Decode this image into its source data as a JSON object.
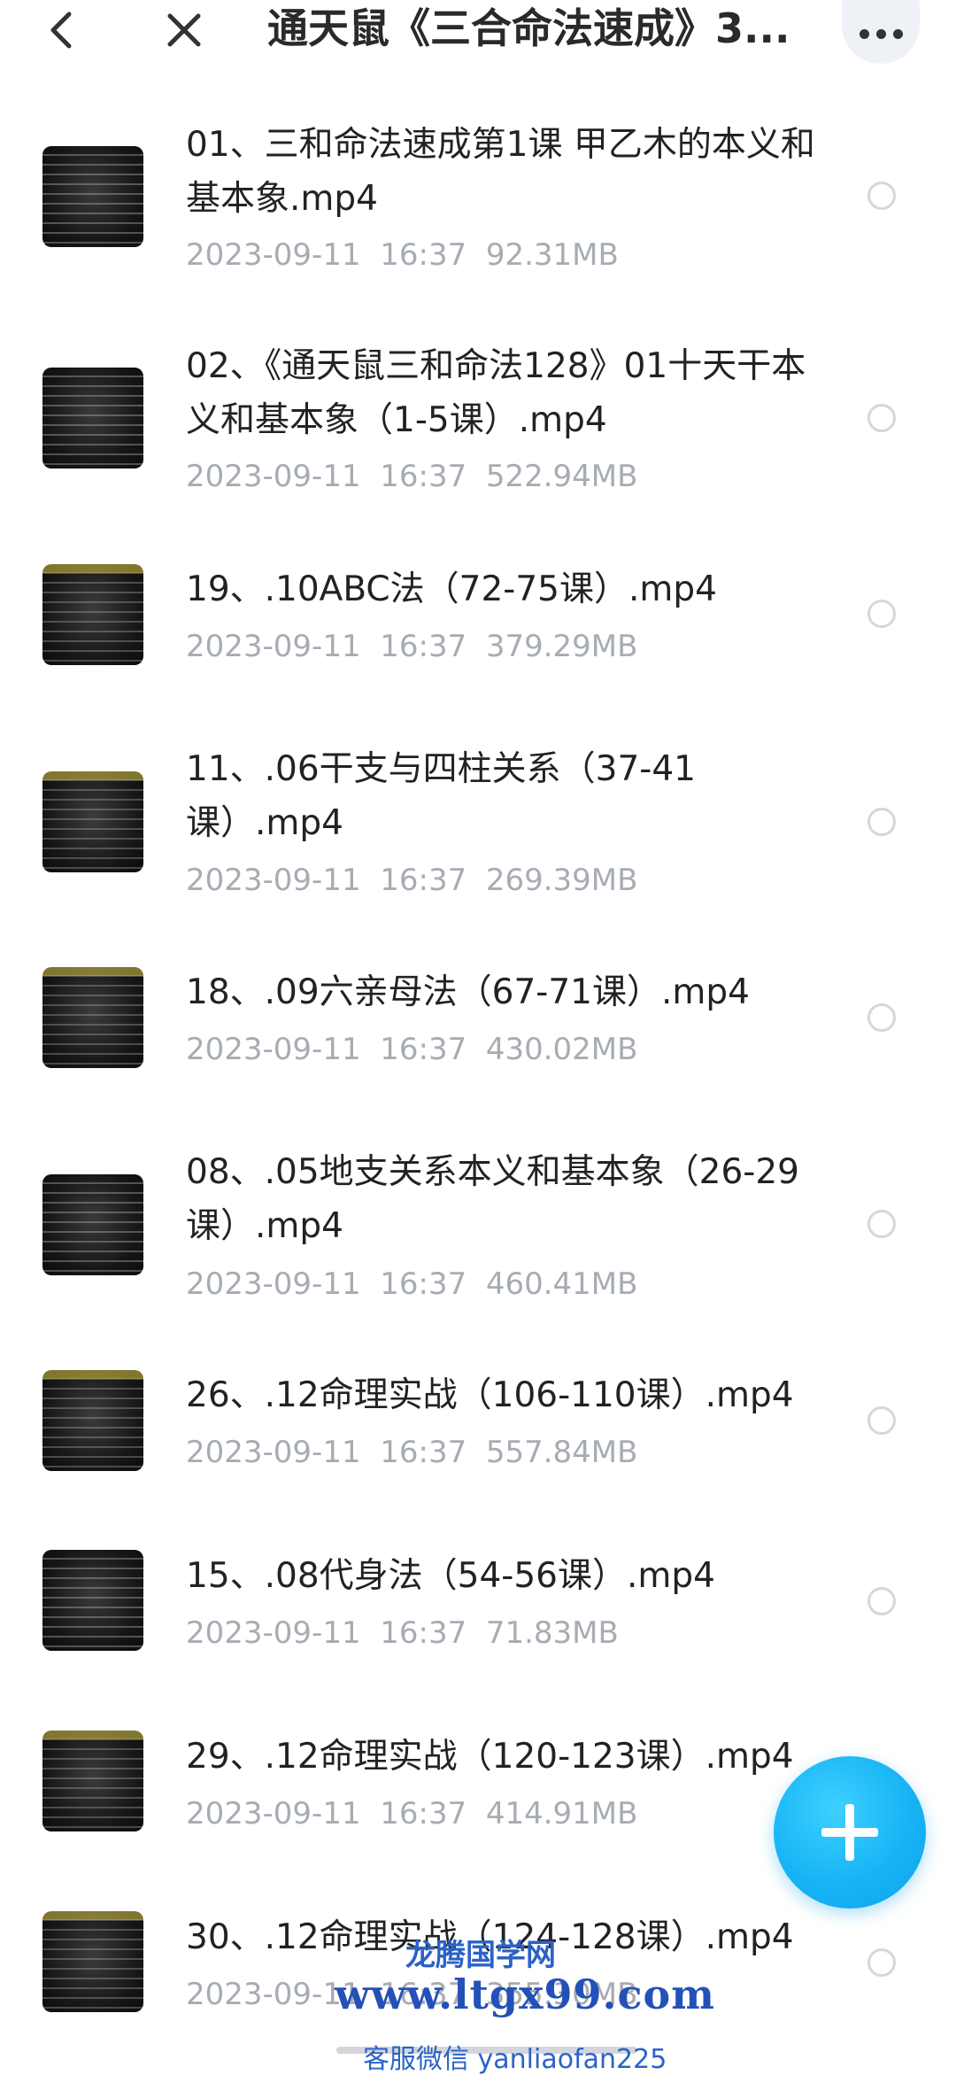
{
  "header": {
    "title": "通天鼠《三合命法速成》3...",
    "back_icon": "chevron-left-icon",
    "close_icon": "close-icon",
    "more_icon": "more-horizontal-icon"
  },
  "files": [
    {
      "name": "01、三和命法速成第1课  甲乙木的本义和基本象.mp4",
      "date": "2023-09-11",
      "time": "16:37",
      "size": "92.31MB"
    },
    {
      "name": "02、《通天鼠三和命法128》01十天干本义和基本象（1-5课）.mp4",
      "date": "2023-09-11",
      "time": "16:37",
      "size": "522.94MB"
    },
    {
      "name": "19、.10ABC法（72-75课）.mp4",
      "date": "2023-09-11",
      "time": "16:37",
      "size": "379.29MB"
    },
    {
      "name": "11、.06干支与四柱关系（37-41课）.mp4",
      "date": "2023-09-11",
      "time": "16:37",
      "size": "269.39MB"
    },
    {
      "name": "18、.09六亲母法（67-71课）.mp4",
      "date": "2023-09-11",
      "time": "16:37",
      "size": "430.02MB"
    },
    {
      "name": "08、.05地支关系本义和基本象（26-29课）.mp4",
      "date": "2023-09-11",
      "time": "16:37",
      "size": "460.41MB"
    },
    {
      "name": "26、.12命理实战（106-110课）.mp4",
      "date": "2023-09-11",
      "time": "16:37",
      "size": "557.84MB"
    },
    {
      "name": "15、.08代身法（54-56课）.mp4",
      "date": "2023-09-11",
      "time": "16:37",
      "size": "71.83MB"
    },
    {
      "name": "29、.12命理实战（120-123课）.mp4",
      "date": "2023-09-11",
      "time": "16:37",
      "size": "414.91MB"
    },
    {
      "name": "30、.12命理实战（124-128课）.mp4",
      "date": "2023-09-11",
      "time": "16:37",
      "size": "355.30MB"
    }
  ],
  "fab_icon": "plus-icon",
  "watermark": {
    "line1": "龙腾国学网",
    "line2": "www.ltgx99.com",
    "line3": "客服微信 yanliaofan225"
  },
  "colors": {
    "accent": "#17b4f5",
    "meta_text": "#a7acb4",
    "watermark": "#2b62c8"
  }
}
